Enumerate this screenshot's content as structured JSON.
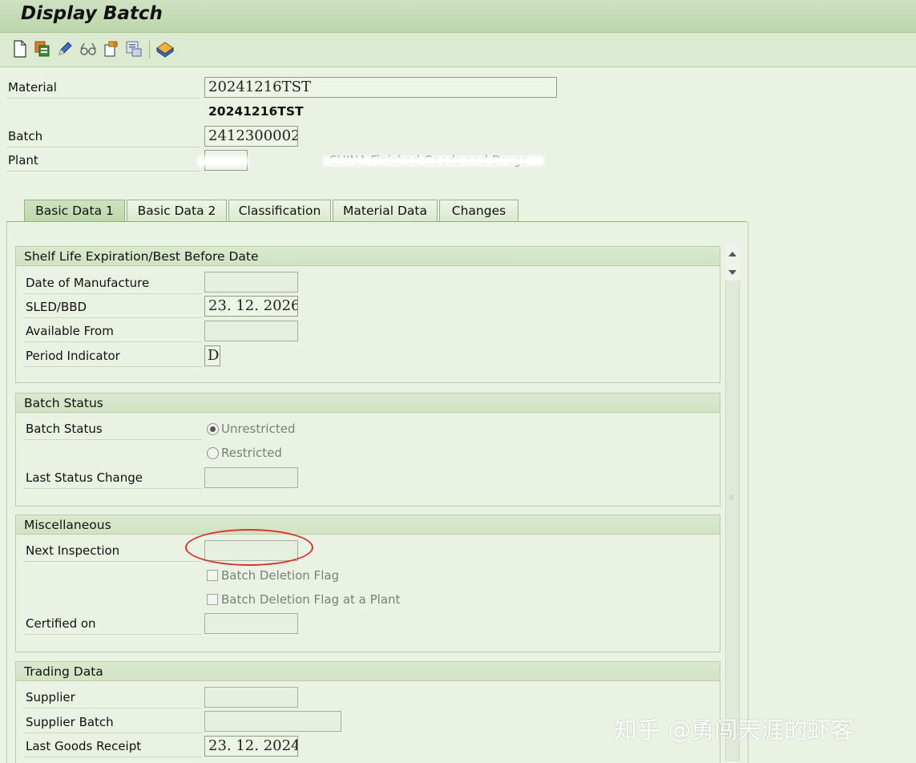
{
  "window": {
    "title": "Display Batch"
  },
  "toolbar": {
    "icons": [
      "create-icon",
      "copy-icon",
      "edit-icon",
      "display-icon",
      "other-batch-icon",
      "where-used-icon",
      "stock-icon"
    ]
  },
  "header": {
    "material_label": "Material",
    "material_value": "20241216TST",
    "material_description": "20241216TST",
    "batch_label": "Batch",
    "batch_value": "2412300002",
    "plant_label": "Plant",
    "plant_value": "",
    "plant_description": "CHINA Finished Goods and Drugs"
  },
  "tabs": [
    {
      "label": "Basic Data 1",
      "active": true
    },
    {
      "label": "Basic Data 2",
      "active": false
    },
    {
      "label": "Classification",
      "active": false
    },
    {
      "label": "Material Data",
      "active": false
    },
    {
      "label": "Changes",
      "active": false
    }
  ],
  "shelf_life": {
    "title": "Shelf Life Expiration/Best Before Date",
    "date_of_manufacture_label": "Date of Manufacture",
    "date_of_manufacture_value": "",
    "sled_label": "SLED/BBD",
    "sled_value": "23. 12. 2026",
    "available_from_label": "Available From",
    "available_from_value": "",
    "period_indicator_label": "Period Indicator",
    "period_indicator_value": "D"
  },
  "batch_status": {
    "title": "Batch Status",
    "status_label": "Batch Status",
    "options": [
      "Unrestricted",
      "Restricted"
    ],
    "selected": "Unrestricted",
    "last_change_label": "Last Status Change",
    "last_change_value": ""
  },
  "misc": {
    "title": "Miscellaneous",
    "next_inspection_label": "Next Inspection",
    "next_inspection_value": "",
    "deletion_flag_label": "Batch Deletion Flag",
    "deletion_flag_plant_label": "Batch Deletion Flag at a Plant",
    "certified_on_label": "Certified on",
    "certified_on_value": ""
  },
  "trading": {
    "title": "Trading Data",
    "supplier_label": "Supplier",
    "supplier_value": "",
    "supplier_batch_label": "Supplier Batch",
    "supplier_batch_value": "",
    "last_gr_label": "Last Goods Receipt",
    "last_gr_value": "23. 12. 2024"
  },
  "watermark": "知乎 @勇闯天涯的虾客",
  "colors": {
    "title_bar": "#c4dbb4",
    "background": "#e9f2e3",
    "highlight_ellipse": "#d8332c"
  }
}
